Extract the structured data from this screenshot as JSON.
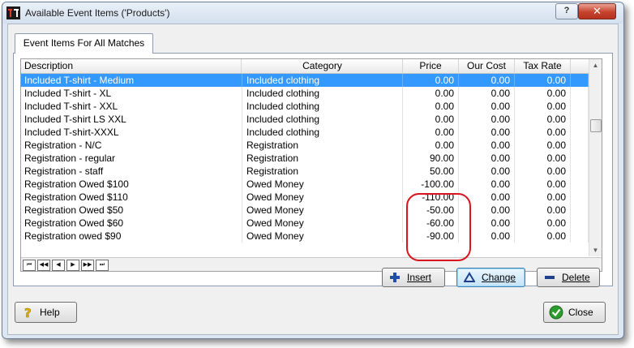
{
  "window": {
    "title": "Available Event Items ('Products')",
    "help_glyph": "?",
    "close_glyph": "✕",
    "app_icon": "app-logo-icon"
  },
  "tabs": [
    {
      "label": "Event Items For All Matches",
      "active": true
    }
  ],
  "grid": {
    "columns": [
      "Description",
      "Category",
      "Price",
      "Our Cost",
      "Tax Rate"
    ],
    "rows": [
      {
        "description": "Included T-shirt - Medium",
        "category": "Included clothing",
        "price": "0.00",
        "cost": "0.00",
        "tax": "0.00",
        "selected": true
      },
      {
        "description": "Included T-shirt - XL",
        "category": "Included clothing",
        "price": "0.00",
        "cost": "0.00",
        "tax": "0.00"
      },
      {
        "description": "Included T-shirt - XXL",
        "category": "Included clothing",
        "price": "0.00",
        "cost": "0.00",
        "tax": "0.00"
      },
      {
        "description": "Included T-shirt LS XXL",
        "category": "Included clothing",
        "price": "0.00",
        "cost": "0.00",
        "tax": "0.00"
      },
      {
        "description": "Included T-shirt-XXXL",
        "category": "Included clothing",
        "price": "0.00",
        "cost": "0.00",
        "tax": "0.00"
      },
      {
        "description": "Registration - N/C",
        "category": "Registration",
        "price": "0.00",
        "cost": "0.00",
        "tax": "0.00"
      },
      {
        "description": "Registration - regular",
        "category": "Registration",
        "price": "90.00",
        "cost": "0.00",
        "tax": "0.00"
      },
      {
        "description": "Registration - staff",
        "category": "Registration",
        "price": "50.00",
        "cost": "0.00",
        "tax": "0.00"
      },
      {
        "description": "Registration Owed $100",
        "category": "Owed Money",
        "price": "-100.00",
        "cost": "0.00",
        "tax": "0.00"
      },
      {
        "description": "Registration Owed $110",
        "category": "Owed Money",
        "price": "-110.00",
        "cost": "0.00",
        "tax": "0.00"
      },
      {
        "description": "Registration Owed $50",
        "category": "Owed Money",
        "price": "-50.00",
        "cost": "0.00",
        "tax": "0.00"
      },
      {
        "description": "Registration Owed $60",
        "category": "Owed Money",
        "price": "-60.00",
        "cost": "0.00",
        "tax": "0.00"
      },
      {
        "description": "Registration owed $90",
        "category": "Owed Money",
        "price": "-90.00",
        "cost": "0.00",
        "tax": "0.00"
      }
    ],
    "navigator": [
      "⏮",
      "◀◀",
      "◀",
      "▶",
      "▶▶",
      "⏭"
    ],
    "scroll_up_glyph": "▲",
    "scroll_down_glyph": "▼"
  },
  "buttons": {
    "insert": "Insert",
    "change": "Change",
    "delete": "Delete",
    "help": "Help",
    "close": "Close"
  },
  "icons": {
    "insert": "plus-icon",
    "change": "triangle-icon",
    "delete": "minus-icon",
    "help": "question-icon",
    "close": "check-icon"
  },
  "colors": {
    "selection": "#3399ff",
    "highlight_ring": "#d9141e",
    "insert_icon": "#1f4fa8",
    "close_icon": "#2e9b2e"
  }
}
